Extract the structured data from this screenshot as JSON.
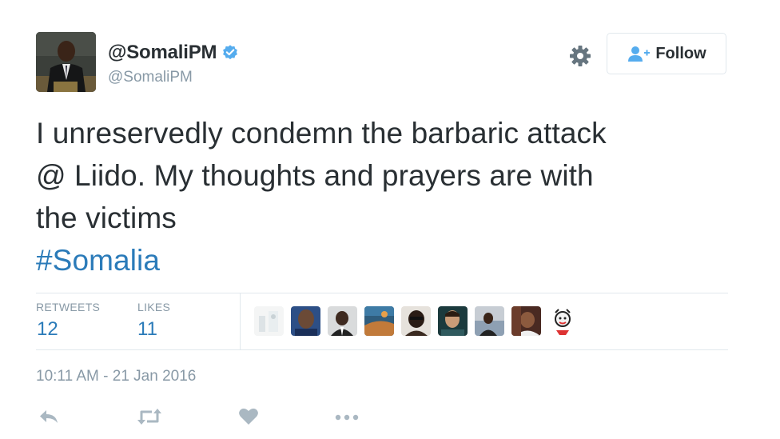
{
  "tweet": {
    "display_name": "@SomaliPM",
    "screen_name": "@SomaliPM",
    "verified": true,
    "text_lines": [
      "I unreservedly condemn the barbaric attack",
      "@ Liido. My thoughts and prayers are with",
      "the victims"
    ],
    "hashtag": "#Somalia",
    "timestamp": "10:11 AM - 21 Jan 2016"
  },
  "follow_button": {
    "label": "Follow"
  },
  "stats": {
    "retweets_label": "RETWEETS",
    "retweets_value": "12",
    "likes_label": "LIKES",
    "likes_value": "11"
  },
  "colors": {
    "link": "#2b7bb9",
    "muted": "#8899a6",
    "text": "#292f33",
    "verified": "#55acee",
    "divider": "#e1e8ed"
  },
  "icons": {
    "settings": "gear-icon",
    "follow": "follow-user-icon",
    "verified": "verified-badge-icon",
    "reply": "reply-icon",
    "retweet": "retweet-icon",
    "like": "heart-icon",
    "more": "more-icon"
  }
}
